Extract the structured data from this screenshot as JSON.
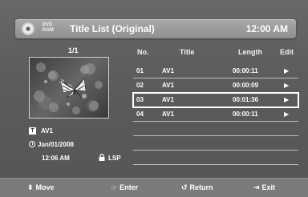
{
  "header": {
    "disc_line1": "DVD",
    "disc_line2": "-RAM",
    "title": "Title List (Original)",
    "clock": "12:00 AM"
  },
  "preview": {
    "page": "1/1",
    "title": "AV1",
    "date": "Jan/01/2008",
    "time": "12:06 AM",
    "mode": "LSP"
  },
  "table": {
    "headers": {
      "no": "No.",
      "title": "Title",
      "length": "Length",
      "edit": "Edit"
    },
    "rows": [
      {
        "no": "01",
        "title": "AV1",
        "length": "00:00:11",
        "edit": "▶"
      },
      {
        "no": "02",
        "title": "AV1",
        "length": "00:00:09",
        "edit": "▶"
      },
      {
        "no": "03",
        "title": "AV1",
        "length": "00:01:36",
        "edit": "▶"
      },
      {
        "no": "04",
        "title": "AV1",
        "length": "00:00:11",
        "edit": "▶"
      }
    ],
    "selected_row": 3
  },
  "footer": {
    "move": {
      "icon": "⬍",
      "label": "Move"
    },
    "enter": {
      "icon": "☞",
      "label": "Enter"
    },
    "return": {
      "icon": "↺",
      "label": "Return"
    },
    "exit": {
      "icon": "⇥",
      "label": "Exit"
    }
  }
}
